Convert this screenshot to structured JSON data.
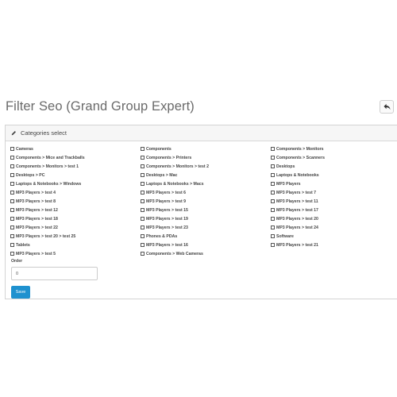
{
  "page": {
    "title": "Filter Seo (Grand Group Expert)"
  },
  "panel": {
    "heading": "Categories select"
  },
  "categories": [
    "Cameras",
    "Components",
    "Components > Monitors",
    "Components > Mice and Trackballs",
    "Components > Printers",
    "Components > Scanners",
    "Components > Monitors > test 1",
    "Components > Monitors > test 2",
    "Desktops",
    "Desktops > PC",
    "Desktops > Mac",
    "Laptops & Notebooks",
    "Laptops & Notebooks > Windows",
    "Laptops & Notebooks > Macs",
    "MP3 Players",
    "MP3 Players > test 4",
    "MP3 Players > test 6",
    "MP3 Players > test 7",
    "MP3 Players > test 8",
    "MP3 Players > test 9",
    "MP3 Players > test 11",
    "MP3 Players > test 12",
    "MP3 Players > test 15",
    "MP3 Players > test 17",
    "MP3 Players > test 18",
    "MP3 Players > test 19",
    "MP3 Players > test 20",
    "MP3 Players > test 22",
    "MP3 Players > test 23",
    "MP3 Players > test 24",
    "MP3 Players > test 20 > test 25",
    "Phones & PDAs",
    "Software",
    "Tablets",
    "MP3 Players > test 16",
    "MP3 Players > test 21",
    "MP3 Players > test 5",
    "Components > Web Cameras",
    ""
  ],
  "form": {
    "order_label": "Order",
    "order_value": "0",
    "save_label": "Save"
  },
  "colors": {
    "primary_button": "#1e91cf",
    "title_text": "#6a6a6a"
  },
  "icons": {
    "back": "reply-icon",
    "heading": "pencil-icon"
  }
}
